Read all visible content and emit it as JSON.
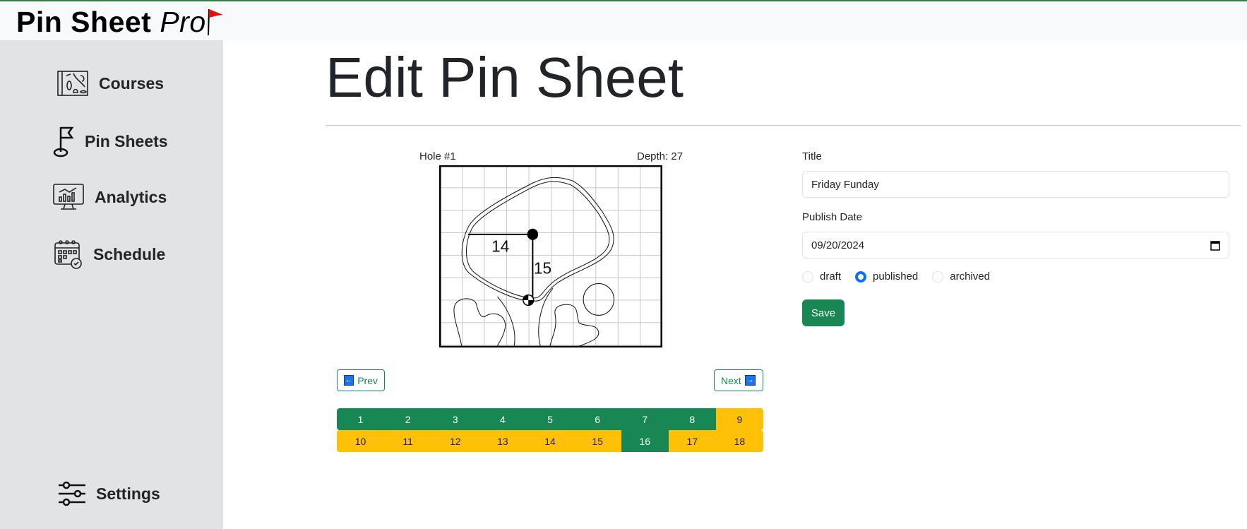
{
  "app": {
    "brand": "Pin Sheet",
    "brand_suffix": "Pro",
    "brand_flag_color": "#e01010"
  },
  "sidebar": {
    "items": [
      {
        "label": "Courses",
        "icon": "course-map-icon"
      },
      {
        "label": "Pin Sheets",
        "icon": "golf-flag-icon"
      },
      {
        "label": "Analytics",
        "icon": "analytics-monitor-icon"
      },
      {
        "label": "Schedule",
        "icon": "calendar-check-icon"
      }
    ],
    "settings": {
      "label": "Settings",
      "icon": "sliders-icon"
    }
  },
  "page": {
    "title": "Edit Pin Sheet"
  },
  "hole": {
    "label": "Hole #1",
    "depth": "Depth: 27",
    "from_left": "14",
    "from_front": "15"
  },
  "nav": {
    "prev": "Prev",
    "next": "Next"
  },
  "holes": [
    {
      "n": "1",
      "status": "done"
    },
    {
      "n": "2",
      "status": "done"
    },
    {
      "n": "3",
      "status": "done"
    },
    {
      "n": "4",
      "status": "done"
    },
    {
      "n": "5",
      "status": "done"
    },
    {
      "n": "6",
      "status": "done"
    },
    {
      "n": "7",
      "status": "done"
    },
    {
      "n": "8",
      "status": "done"
    },
    {
      "n": "9",
      "status": "pending"
    },
    {
      "n": "10",
      "status": "pending"
    },
    {
      "n": "11",
      "status": "pending"
    },
    {
      "n": "12",
      "status": "pending"
    },
    {
      "n": "13",
      "status": "pending"
    },
    {
      "n": "14",
      "status": "pending"
    },
    {
      "n": "15",
      "status": "pending"
    },
    {
      "n": "16",
      "status": "done"
    },
    {
      "n": "17",
      "status": "pending"
    },
    {
      "n": "18",
      "status": "pending"
    }
  ],
  "form": {
    "title_label": "Title",
    "title_value": "Friday Funday",
    "date_label": "Publish Date",
    "date_value": "09/20/2024",
    "status_options": [
      "draft",
      "published",
      "archived"
    ],
    "status_selected": "published",
    "save": "Save"
  },
  "colors": {
    "done": "#198754",
    "pending": "#ffc107",
    "radio": "#0d6efd"
  }
}
